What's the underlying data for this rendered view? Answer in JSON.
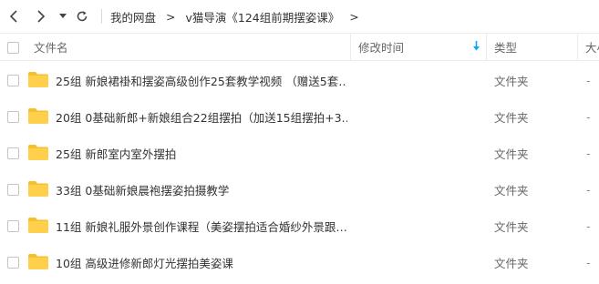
{
  "breadcrumb": {
    "items": [
      "我的网盘",
      "v猫导演《124组前期摆姿课》"
    ],
    "separator": ">",
    "trailing": ">"
  },
  "columns": {
    "name": "文件名",
    "modified": "修改时间",
    "type": "类型",
    "size": "大小"
  },
  "sort": {
    "column": "modified",
    "direction": "desc"
  },
  "files": [
    {
      "name": "25组 新娘裙褂和摆姿高级创作25套教学视频 （赠送5套…",
      "type": "文件夹",
      "size": "-"
    },
    {
      "name": "20组 0基础新郎+新娘组合22组摆拍（加送15组摆拍+3…",
      "type": "文件夹",
      "size": "-"
    },
    {
      "name": "25组 新郎室内室外摆拍",
      "type": "文件夹",
      "size": "-"
    },
    {
      "name": "33组 0基础新娘晨袍摆姿拍摄教学",
      "type": "文件夹",
      "size": "-"
    },
    {
      "name": "11组 新娘礼服外景创作课程（美姿摆拍适合婚纱外景跟…",
      "type": "文件夹",
      "size": "-"
    },
    {
      "name": "10组 高级进修新郎灯光摆拍美姿课",
      "type": "文件夹",
      "size": "-"
    }
  ],
  "colors": {
    "accent": "#06a7ff",
    "folder": "#ffd04b",
    "folder_tab": "#f7bf2a"
  }
}
